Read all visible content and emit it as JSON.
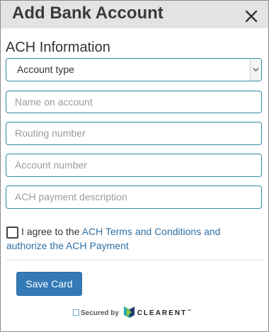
{
  "dialog": {
    "title": "Add Bank Account",
    "close_icon": "close-icon"
  },
  "form": {
    "section_title": "ACH Information",
    "account_type": {
      "selected": "Account type",
      "icon": "chevron-down-icon"
    },
    "name_on_account": {
      "placeholder": "Name on account",
      "value": ""
    },
    "routing_number": {
      "placeholder": "Routing number",
      "value": ""
    },
    "account_number": {
      "placeholder": "Account number",
      "value": ""
    },
    "payment_description": {
      "placeholder": "ACH payment description",
      "value": ""
    },
    "agree": {
      "checked": false,
      "prefix": "I agree to the ",
      "link_text": "ACH Terms and Conditions and authorize the ACH Payment"
    }
  },
  "footer": {
    "save_label": "Save Card",
    "secured_label": "Secured by",
    "brand_name": "CLEARENT",
    "brand_tm": "™"
  },
  "colors": {
    "title_bar": "#e3e3e3",
    "field_border": "#2f8aa8",
    "link": "#2f6fa3",
    "button": "#337ab7"
  }
}
